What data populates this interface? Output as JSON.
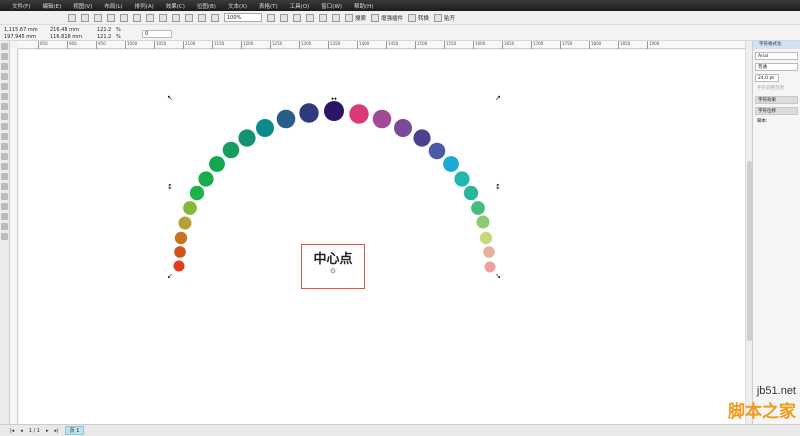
{
  "menu": [
    "文件(F)",
    "编辑(E)",
    "视图(V)",
    "布局(L)",
    "排列(A)",
    "效果(C)",
    "位图(B)",
    "文本(X)",
    "表格(T)",
    "工具(O)",
    "窗口(W)",
    "帮助(H)"
  ],
  "toolbar": {
    "zoom": "100%",
    "buttons": [
      "搜索",
      "增强插件",
      "转换",
      "贴齐"
    ]
  },
  "propbar": {
    "x": "1,115.67 mm",
    "y": "197.945 mm",
    "w": "216.48 mm",
    "h": "116.818 mm",
    "sx": "121.2",
    "sy": "121.2",
    "pct": "%",
    "angle": "0"
  },
  "ruler": [
    "850",
    "900",
    "950",
    "1000",
    "1050",
    "1100",
    "1150",
    "1200",
    "1250",
    "1300",
    "1350",
    "1400",
    "1450",
    "1500",
    "1550",
    "1600",
    "1650",
    "1700",
    "1750",
    "1800",
    "1850",
    "1900"
  ],
  "canvas": {
    "center_label": "中心点",
    "circle_colors": [
      "#e8391a",
      "#d0541a",
      "#c8731f",
      "#b5a03a",
      "#86b83a",
      "#1db34a",
      "#18ad4a",
      "#12a850",
      "#159e5e",
      "#149072",
      "#0e8a8a",
      "#2a5e8a",
      "#2d3a7c",
      "#2a1566",
      "#d93a78",
      "#a24a96",
      "#7b4a98",
      "#4e4090",
      "#4a5aa8",
      "#1ba9d8",
      "#21b6b0",
      "#2cb59a",
      "#48bc80",
      "#8ccc70",
      "#c8d878",
      "#e8b0a0",
      "#f0a0a0"
    ],
    "highlight_color": "#d9534f"
  },
  "docker": {
    "title": "字符格式化",
    "font": "Arial",
    "style": "普通",
    "size": "24.0 pt",
    "range": "字符调整范围",
    "effects": "字符效果",
    "shift": "字符位移",
    "script": "脚本:"
  },
  "status": {
    "page": "1 / 1",
    "page_tab": "页 1"
  },
  "watermark": {
    "line1": "jb51.net",
    "line2": "脚本之家"
  }
}
